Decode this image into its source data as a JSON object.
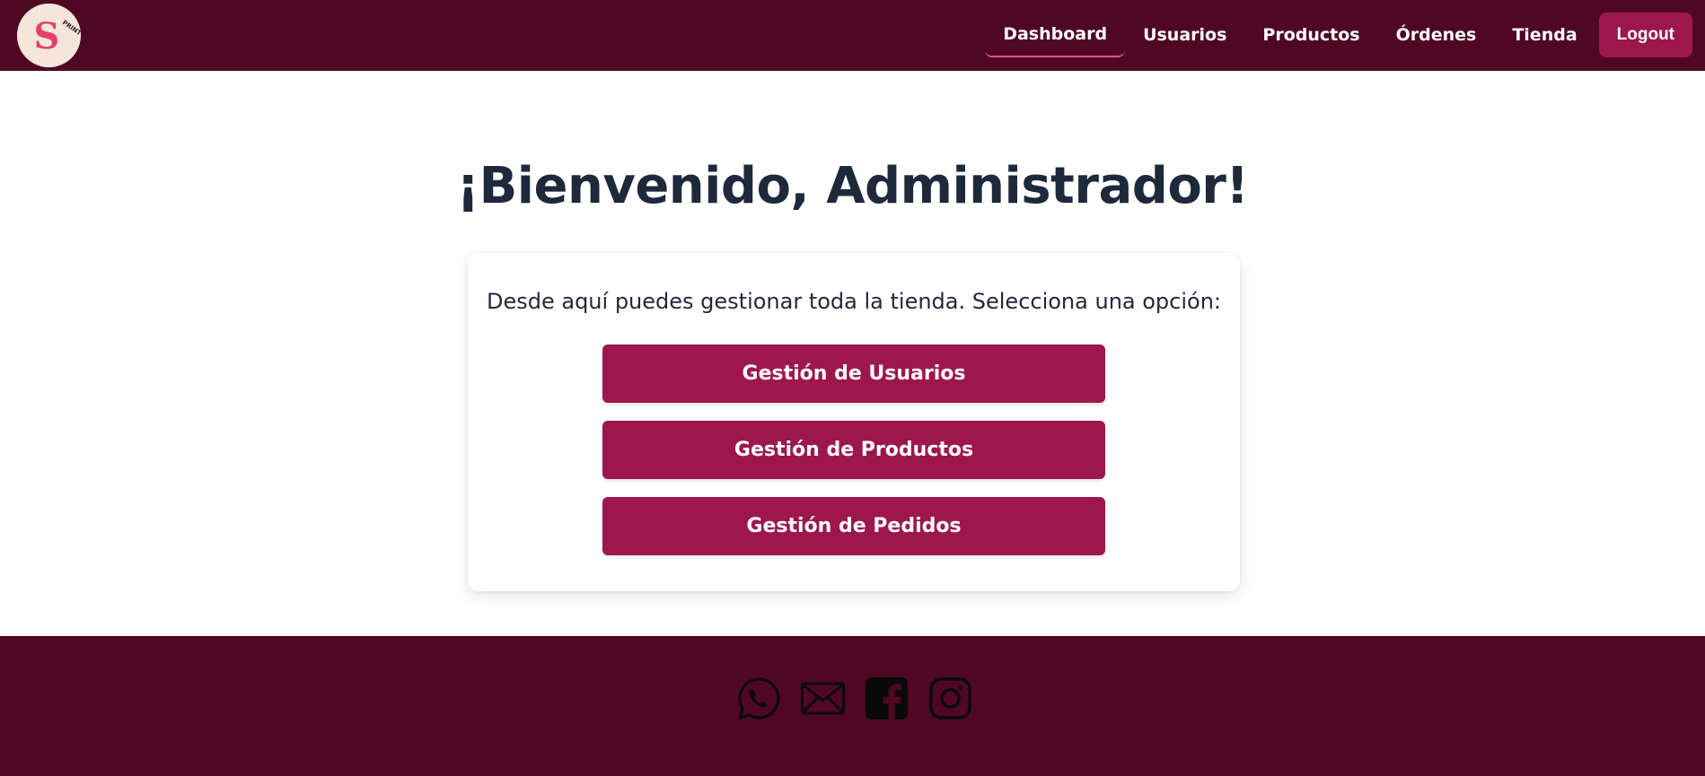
{
  "header": {
    "logo_icon": "s-print-logo-icon",
    "nav": [
      {
        "label": "Dashboard",
        "active": true
      },
      {
        "label": "Usuarios",
        "active": false
      },
      {
        "label": "Productos",
        "active": false
      },
      {
        "label": "Órdenes",
        "active": false
      },
      {
        "label": "Tienda",
        "active": false
      }
    ],
    "logout_label": "Logout"
  },
  "main": {
    "title": "¡Bienvenido, Administrador!",
    "intro": "Desde aquí puedes gestionar toda la tienda. Selecciona una opción:",
    "buttons": [
      {
        "label": "Gestión de Usuarios"
      },
      {
        "label": "Gestión de Productos"
      },
      {
        "label": "Gestión de Pedidos"
      }
    ]
  },
  "footer": {
    "social_icons": [
      "whatsapp-icon",
      "mail-icon",
      "facebook-icon",
      "instagram-icon"
    ]
  },
  "colors": {
    "header_bg": "#500724",
    "accent": "#9d174d",
    "active_underline": "#ec4899",
    "title_text": "#1e293b",
    "logo_bg": "#f5e6dc"
  }
}
